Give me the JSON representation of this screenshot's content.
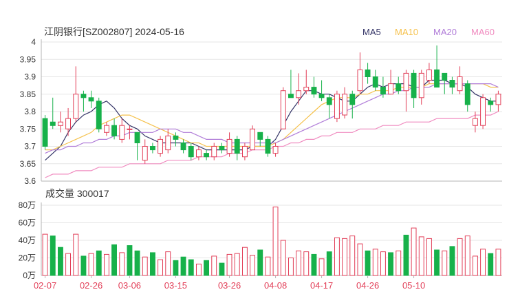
{
  "header": {
    "title": "江阴银行[SZ002807] 2024-05-16",
    "legend": [
      {
        "label": "MA5",
        "color": "#333366"
      },
      {
        "label": "MA10",
        "color": "#f5c14b"
      },
      {
        "label": "MA20",
        "color": "#b07cd8"
      },
      {
        "label": "MA60",
        "color": "#f08cc0"
      }
    ]
  },
  "volume_panel": {
    "title": "成交量 300017"
  },
  "colors": {
    "up": "#e23e57",
    "down": "#17b14a",
    "grid": "#e6e6e6",
    "axis": "#b5b5b5"
  },
  "chart_data": [
    {
      "type": "candlestick",
      "title": "江阴银行[SZ002807] 2024-05-16",
      "y_ticks": [
        "3.6",
        "3.65",
        "3.7",
        "3.75",
        "3.8",
        "3.85",
        "3.9",
        "3.95",
        "4"
      ],
      "ylim": [
        3.6,
        4.0
      ],
      "x_ticks": [
        {
          "index": 0,
          "label": "02-07"
        },
        {
          "index": 6,
          "label": "02-26"
        },
        {
          "index": 11,
          "label": "03-06"
        },
        {
          "index": 17,
          "label": "03-15"
        },
        {
          "index": 24,
          "label": "03-26"
        },
        {
          "index": 30,
          "label": "04-08"
        },
        {
          "index": 36,
          "label": "04-17"
        },
        {
          "index": 42,
          "label": "04-26"
        },
        {
          "index": 48,
          "label": "05-10"
        }
      ],
      "candles": [
        [
          3.78,
          3.7,
          3.79,
          3.69
        ],
        [
          3.77,
          3.76,
          3.84,
          3.75
        ],
        [
          3.76,
          3.77,
          3.8,
          3.74
        ],
        [
          3.75,
          3.78,
          3.81,
          3.73
        ],
        [
          3.78,
          3.85,
          3.93,
          3.77
        ],
        [
          3.85,
          3.84,
          3.86,
          3.8
        ],
        [
          3.84,
          3.83,
          3.86,
          3.81
        ],
        [
          3.83,
          3.75,
          3.84,
          3.74
        ],
        [
          3.74,
          3.76,
          3.77,
          3.73
        ],
        [
          3.76,
          3.73,
          3.78,
          3.72
        ],
        [
          3.72,
          3.76,
          3.78,
          3.71
        ],
        [
          3.75,
          3.75,
          3.76,
          3.72
        ],
        [
          3.74,
          3.71,
          3.74,
          3.66
        ],
        [
          3.66,
          3.7,
          3.72,
          3.65
        ],
        [
          3.7,
          3.69,
          3.71,
          3.68
        ],
        [
          3.68,
          3.72,
          3.73,
          3.67
        ],
        [
          3.69,
          3.73,
          3.75,
          3.68
        ],
        [
          3.73,
          3.72,
          3.74,
          3.7
        ],
        [
          3.71,
          3.69,
          3.72,
          3.68
        ],
        [
          3.7,
          3.67,
          3.71,
          3.66
        ],
        [
          3.67,
          3.69,
          3.7,
          3.66
        ],
        [
          3.68,
          3.67,
          3.69,
          3.66
        ],
        [
          3.67,
          3.7,
          3.71,
          3.66
        ],
        [
          3.7,
          3.69,
          3.71,
          3.68
        ],
        [
          3.68,
          3.72,
          3.74,
          3.67
        ],
        [
          3.72,
          3.68,
          3.73,
          3.66
        ],
        [
          3.67,
          3.7,
          3.71,
          3.66
        ],
        [
          3.69,
          3.75,
          3.76,
          3.69
        ],
        [
          3.74,
          3.72,
          3.74,
          3.7
        ],
        [
          3.72,
          3.68,
          3.73,
          3.67
        ],
        [
          3.68,
          3.7,
          3.71,
          3.67
        ],
        [
          3.75,
          3.86,
          3.87,
          3.75
        ],
        [
          3.85,
          3.84,
          3.92,
          3.84
        ],
        [
          3.84,
          3.86,
          3.91,
          3.82
        ],
        [
          3.86,
          3.87,
          3.92,
          3.85
        ],
        [
          3.87,
          3.85,
          3.9,
          3.84
        ],
        [
          3.85,
          3.84,
          3.89,
          3.83
        ],
        [
          3.84,
          3.82,
          3.85,
          3.78
        ],
        [
          3.78,
          3.85,
          3.86,
          3.77
        ],
        [
          3.79,
          3.85,
          3.87,
          3.78
        ],
        [
          3.85,
          3.82,
          3.86,
          3.78
        ],
        [
          3.86,
          3.92,
          3.97,
          3.85
        ],
        [
          3.92,
          3.9,
          3.94,
          3.88
        ],
        [
          3.9,
          3.87,
          3.92,
          3.86
        ],
        [
          3.87,
          3.85,
          3.9,
          3.84
        ],
        [
          3.85,
          3.88,
          3.92,
          3.85
        ],
        [
          3.88,
          3.86,
          3.9,
          3.85
        ],
        [
          3.86,
          3.91,
          3.92,
          3.8
        ],
        [
          3.91,
          3.84,
          3.92,
          3.81
        ],
        [
          3.84,
          3.91,
          3.92,
          3.82
        ],
        [
          3.89,
          3.92,
          3.94,
          3.88
        ],
        [
          3.92,
          3.87,
          3.99,
          3.87
        ],
        [
          3.91,
          3.89,
          3.91,
          3.85
        ],
        [
          3.89,
          3.87,
          3.9,
          3.85
        ],
        [
          3.86,
          3.9,
          3.93,
          3.85
        ],
        [
          3.88,
          3.82,
          3.89,
          3.8
        ],
        [
          3.76,
          3.78,
          3.8,
          3.74
        ],
        [
          3.76,
          3.84,
          3.85,
          3.75
        ],
        [
          3.83,
          3.82,
          3.84,
          3.8
        ],
        [
          3.82,
          3.85,
          3.86,
          3.8
        ]
      ],
      "ma": [
        {
          "name": "MA5",
          "values": [
            3.66,
            3.68,
            3.7,
            3.74,
            3.77,
            3.79,
            3.8,
            3.82,
            3.83,
            3.81,
            3.78,
            3.76,
            3.75,
            3.73,
            3.72,
            3.71,
            3.71,
            3.71,
            3.71,
            3.71,
            3.7,
            3.69,
            3.69,
            3.69,
            3.69,
            3.69,
            3.69,
            3.7,
            3.7,
            3.7,
            3.72,
            3.76,
            3.8,
            3.83,
            3.86,
            3.86,
            3.85,
            3.85,
            3.84,
            3.83,
            3.83,
            3.85,
            3.87,
            3.88,
            3.87,
            3.88,
            3.88,
            3.88,
            3.87,
            3.87,
            3.89,
            3.89,
            3.89,
            3.88,
            3.88,
            3.87,
            3.85,
            3.84,
            3.83,
            3.83
          ]
        },
        {
          "name": "MA10",
          "values": [
            3.69,
            3.69,
            3.7,
            3.71,
            3.72,
            3.73,
            3.74,
            3.76,
            3.77,
            3.78,
            3.79,
            3.79,
            3.78,
            3.77,
            3.76,
            3.75,
            3.74,
            3.73,
            3.72,
            3.71,
            3.71,
            3.7,
            3.7,
            3.7,
            3.7,
            3.7,
            3.7,
            3.7,
            3.7,
            3.7,
            3.71,
            3.72,
            3.74,
            3.76,
            3.78,
            3.8,
            3.82,
            3.83,
            3.84,
            3.84,
            3.84,
            3.85,
            3.85,
            3.86,
            3.86,
            3.86,
            3.87,
            3.87,
            3.87,
            3.87,
            3.88,
            3.88,
            3.88,
            3.88,
            3.88,
            3.88,
            3.88,
            3.88,
            3.87,
            3.87
          ]
        },
        {
          "name": "MA20",
          "values": [
            3.68,
            3.69,
            3.69,
            3.7,
            3.7,
            3.71,
            3.71,
            3.72,
            3.72,
            3.73,
            3.73,
            3.74,
            3.74,
            3.74,
            3.74,
            3.75,
            3.75,
            3.75,
            3.74,
            3.74,
            3.73,
            3.72,
            3.72,
            3.72,
            3.71,
            3.71,
            3.71,
            3.71,
            3.71,
            3.71,
            3.71,
            3.72,
            3.73,
            3.74,
            3.75,
            3.76,
            3.77,
            3.78,
            3.79,
            3.8,
            3.81,
            3.82,
            3.83,
            3.84,
            3.85,
            3.85,
            3.86,
            3.86,
            3.87,
            3.87,
            3.87,
            3.88,
            3.88,
            3.88,
            3.88,
            3.88,
            3.88,
            3.88,
            3.88,
            3.87
          ]
        },
        {
          "name": "MA60",
          "values": [
            3.61,
            3.62,
            3.62,
            3.62,
            3.63,
            3.63,
            3.63,
            3.64,
            3.64,
            3.64,
            3.64,
            3.65,
            3.65,
            3.65,
            3.65,
            3.65,
            3.66,
            3.66,
            3.66,
            3.66,
            3.67,
            3.67,
            3.67,
            3.67,
            3.68,
            3.68,
            3.68,
            3.69,
            3.69,
            3.69,
            3.7,
            3.7,
            3.71,
            3.71,
            3.72,
            3.72,
            3.73,
            3.73,
            3.74,
            3.74,
            3.74,
            3.75,
            3.75,
            3.75,
            3.76,
            3.76,
            3.76,
            3.77,
            3.77,
            3.77,
            3.77,
            3.78,
            3.78,
            3.78,
            3.78,
            3.78,
            3.79,
            3.79,
            3.79,
            3.8
          ]
        }
      ]
    },
    {
      "type": "bar",
      "title": "成交量 300017",
      "y_ticks": [
        "0万",
        "20万",
        "40万",
        "60万",
        "80万"
      ],
      "ylim": [
        0,
        80
      ],
      "unit": "万",
      "values": [
        47,
        45,
        32,
        25,
        47,
        22,
        25,
        28,
        24,
        35,
        26,
        34,
        28,
        21,
        26,
        18,
        27,
        17,
        21,
        18,
        13,
        17,
        22,
        14,
        24,
        25,
        32,
        23,
        29,
        21,
        78,
        40,
        20,
        28,
        27,
        24,
        19,
        27,
        43,
        42,
        45,
        36,
        28,
        30,
        27,
        26,
        28,
        46,
        54,
        44,
        42,
        29,
        28,
        33,
        42,
        45,
        22,
        30,
        25,
        30
      ],
      "up": [
        1,
        0,
        0,
        1,
        1,
        0,
        1,
        0,
        1,
        0,
        1,
        0,
        0,
        1,
        0,
        1,
        1,
        0,
        0,
        0,
        1,
        0,
        1,
        0,
        1,
        1,
        1,
        1,
        0,
        1,
        1,
        1,
        1,
        1,
        1,
        0,
        1,
        0,
        1,
        1,
        1,
        1,
        0,
        1,
        1,
        0,
        1,
        0,
        1,
        1,
        1,
        0,
        1,
        0,
        1,
        1,
        1,
        1,
        0,
        1
      ]
    }
  ]
}
